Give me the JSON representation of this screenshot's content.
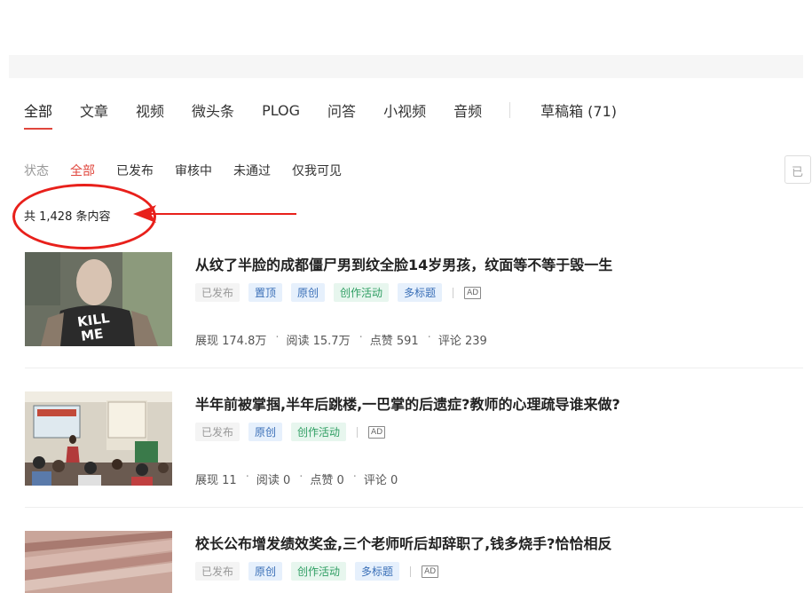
{
  "tabs": [
    {
      "label": "全部"
    },
    {
      "label": "文章"
    },
    {
      "label": "视频"
    },
    {
      "label": "微头条"
    },
    {
      "label": "PLOG"
    },
    {
      "label": "问答"
    },
    {
      "label": "小视频"
    },
    {
      "label": "音频"
    }
  ],
  "drafts_label": "草稿箱 (71)",
  "filter": {
    "label": "状态",
    "options": [
      "全部",
      "已发布",
      "审核中",
      "未通过",
      "仅我可见"
    ]
  },
  "right_box_text": "已",
  "count_text": "共 1,428 条内容",
  "annotation_color": "#e8201b",
  "articles": [
    {
      "title": "从纹了半脸的成都僵尸男到纹全脸14岁男孩，纹面等不等于毁一生",
      "tags": [
        "已发布",
        "置顶",
        "原创",
        "创作活动",
        "多标题"
      ],
      "ad_icon": "AD",
      "stats": [
        "展现 174.8万",
        "阅读 15.7万",
        "点赞 591",
        "评论 239"
      ],
      "thumb_text": "KILL ME"
    },
    {
      "title": "半年前被掌掴,半年后跳楼,一巴掌的后遗症?教师的心理疏导谁来做?",
      "tags": [
        "已发布",
        "原创",
        "创作活动"
      ],
      "ad_icon": "AD",
      "stats": [
        "展现 11",
        "阅读 0",
        "点赞 0",
        "评论 0"
      ]
    },
    {
      "title": "校长公布增发绩效奖金,三个老师听后却辞职了,钱多烧手?恰恰相反",
      "tags": [
        "已发布",
        "原创",
        "创作活动",
        "多标题"
      ],
      "ad_icon": "AD"
    }
  ]
}
